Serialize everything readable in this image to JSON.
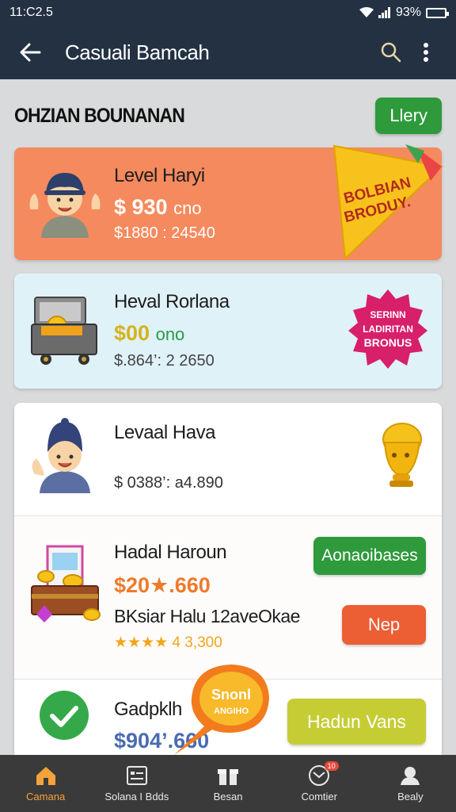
{
  "status_bar": {
    "time": "11:C2.5",
    "battery": "93%"
  },
  "app_bar": {
    "title": "Casuali Bamcah"
  },
  "section": {
    "title": "OHZIAN BOUNANAN",
    "button_label": "Llery"
  },
  "cards": [
    {
      "level": "Level Haryi",
      "amount": "$ 930",
      "amount_suffix": "cno",
      "range": "$1880 : 24540",
      "badge": [
        "BOLBIAN",
        "BRODUY."
      ]
    },
    {
      "level": "Heval Rorlana",
      "amount": "$00",
      "amount_suffix": "ono",
      "range": "$.864’: 2 2650",
      "badge": [
        "SERINN",
        "LADIRITAN",
        "BRONUS"
      ]
    },
    {
      "level": "Levaal Hava",
      "range": "$ 0388’: a4.890"
    },
    {
      "level": "Hadal Haroun",
      "amount": "$20★.660",
      "line2": "BKsiar Halu 12aveOkae",
      "rating": "★★★★ 4 3,300",
      "btn1": "Aonaoibases",
      "btn2": "Nep"
    },
    {
      "level": "Gadpklh",
      "amount": "$904’.660",
      "badge": [
        "Snonl",
        "ANGIHO"
      ],
      "btn": "Hadun Vans"
    }
  ],
  "bottom_nav": [
    {
      "label": "Camana",
      "icon": "home-icon",
      "active": true
    },
    {
      "label": "Solana I Bdds",
      "icon": "list-icon"
    },
    {
      "label": "Besan",
      "icon": "gift-icon"
    },
    {
      "label": "Comtier",
      "icon": "mail-icon",
      "badge": "10"
    },
    {
      "label": "Bealy",
      "icon": "profile-icon"
    }
  ],
  "colors": {
    "bar": "#233143",
    "orange": "#f58a5e",
    "green": "#2e9a3c",
    "nav": "#3a3a3a",
    "active": "#f4a23b"
  }
}
